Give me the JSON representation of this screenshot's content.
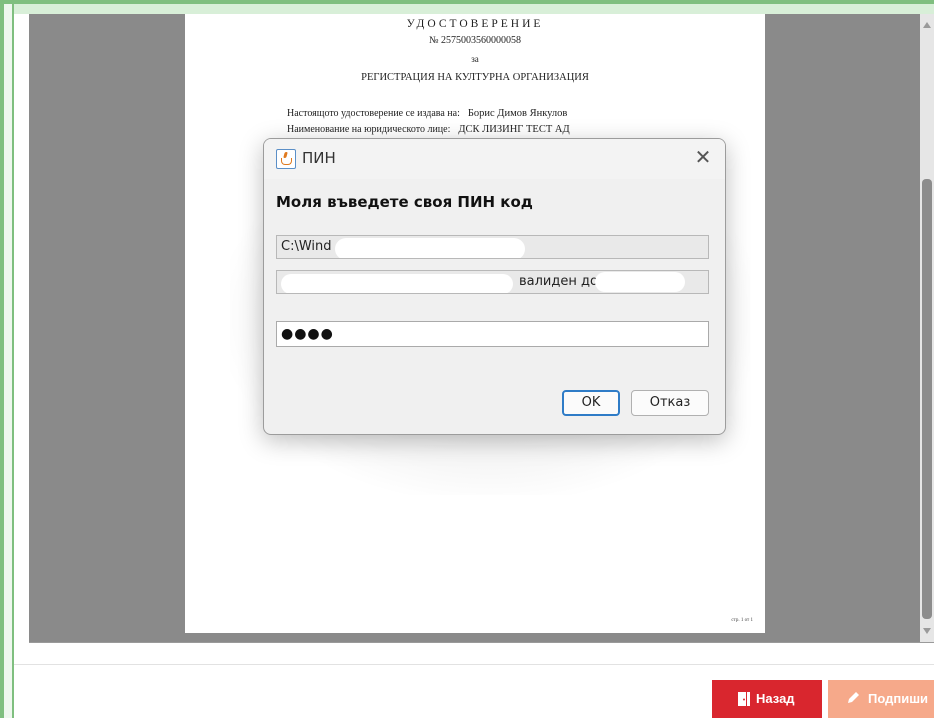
{
  "document": {
    "title": "УДОСТОВЕРЕНИЕ",
    "number": "№ 2575003560000058",
    "for_word": "за",
    "subject": "РЕГИСТРАЦИЯ НА КУЛТУРНА ОРГАНИЗАЦИЯ",
    "line1_label": "Настоящото удостоверение се издава на:",
    "line1_value": "Борис Димов Янкулов",
    "line2_label": "Наименование на юридическото лице:",
    "line2_value": "ДСК ЛИЗИНГ ТЕСТ АД",
    "page_number": "стр. 1 от 1"
  },
  "dialog": {
    "title": "ПИН",
    "prompt": "Моля въведете своя ПИН код",
    "field1_value": "C:\\Wind",
    "field2_suffix": "валиден до",
    "pin_value": "●●●●",
    "ok_label": "OK",
    "cancel_label": "Отказ"
  },
  "footer": {
    "back_label": "Назад",
    "sign_label": "Подпиши"
  },
  "colors": {
    "back_button": "#d9262e",
    "sign_button": "#f6a98a",
    "viewer_background": "#8a8a8a",
    "ok_focus": "#2f7cc7"
  }
}
